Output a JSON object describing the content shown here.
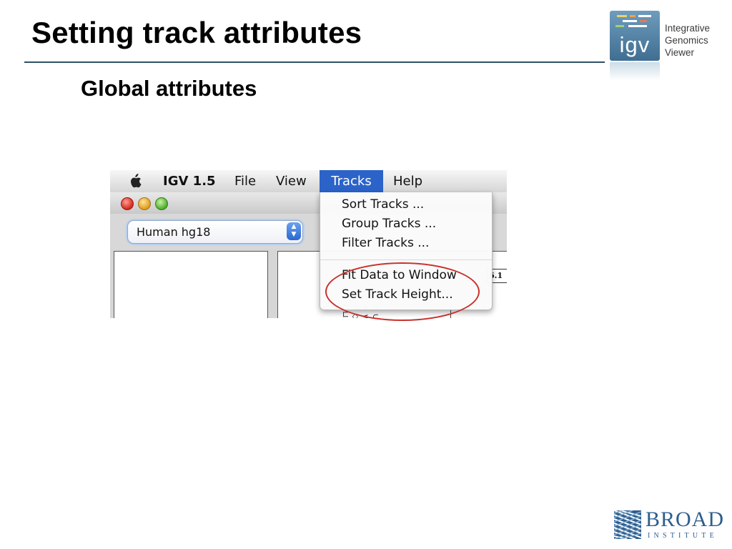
{
  "slide": {
    "title": "Setting track attributes",
    "subtitle": "Global attributes"
  },
  "igv_logo": {
    "mark": "igv",
    "line1": "Integrative",
    "line2": "Genomics",
    "line3": "Viewer"
  },
  "screenshot": {
    "menubar": {
      "apple_icon": "apple-icon",
      "app": "IGV 1.5",
      "file": "File",
      "view": "View",
      "tracks": "Tracks",
      "help": "Help"
    },
    "genome_select": {
      "value": "Human hg18"
    },
    "ruler_label": "6.1",
    "tracks_menu": {
      "items": [
        "Sort Tracks ...",
        "Group Tracks  ...",
        "Filter Tracks ...",
        "Fit Data to Window",
        "Set Track Height..."
      ]
    },
    "highlight_color": "#c8312c",
    "menu_highlight_color": "#2b63c9"
  },
  "broad_logo": {
    "name": "BROAD",
    "subtitle": "INSTITUTE"
  }
}
